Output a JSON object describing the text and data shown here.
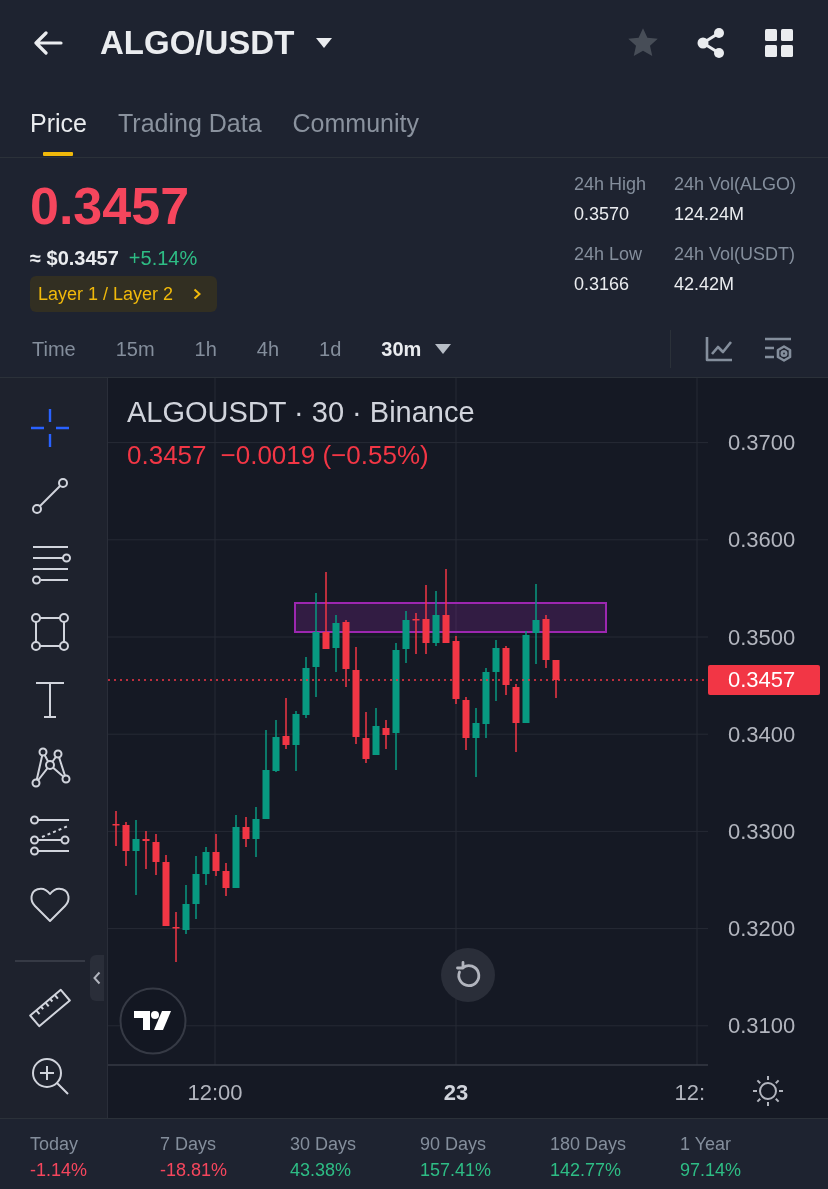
{
  "header": {
    "title": "ALGO/USDT",
    "favorited": false
  },
  "tabs": [
    {
      "label": "Price",
      "selected": true
    },
    {
      "label": "Trading Data",
      "selected": false
    },
    {
      "label": "Community",
      "selected": false
    }
  ],
  "ticker": {
    "price": "0.3457",
    "fiat_price": "≈ $0.3457",
    "change": "+5.14%",
    "category_tag": "Layer 1 / Layer 2"
  },
  "stats": [
    {
      "label": "24h High",
      "value": "0.3570"
    },
    {
      "label": "24h Vol(ALGO)",
      "value": "124.24M"
    },
    {
      "label": "24h Low",
      "value": "0.3166"
    },
    {
      "label": "24h Vol(USDT)",
      "value": "42.42M"
    }
  ],
  "intervals": [
    {
      "label": "Time",
      "selected": false,
      "has_menu": false
    },
    {
      "label": "15m",
      "selected": false,
      "has_menu": false
    },
    {
      "label": "1h",
      "selected": false,
      "has_menu": false
    },
    {
      "label": "4h",
      "selected": false,
      "has_menu": false
    },
    {
      "label": "1d",
      "selected": false,
      "has_menu": false
    },
    {
      "label": "30m",
      "selected": true,
      "has_menu": true
    }
  ],
  "drawing_tools": [
    {
      "kind": "crosshair",
      "selected": true
    },
    {
      "kind": "trend-line",
      "selected": false
    },
    {
      "kind": "fib",
      "selected": false
    },
    {
      "kind": "rectangle",
      "selected": false
    },
    {
      "kind": "text",
      "selected": false
    },
    {
      "kind": "pattern",
      "selected": false
    },
    {
      "kind": "forecast",
      "selected": false
    },
    {
      "kind": "favorites",
      "selected": false
    }
  ],
  "utility_tools": [
    {
      "kind": "ruler",
      "selected": false
    },
    {
      "kind": "zoom",
      "selected": false
    }
  ],
  "chart": {
    "symbol_line": "ALGOUSDT · 30 · Binance",
    "legend_price": "0.3457",
    "legend_change": "−0.0019 (−0.55%)",
    "price_axis": [
      "0.3700",
      "0.3600",
      "0.3500",
      "0.3400",
      "0.3300",
      "0.3200",
      "0.3100"
    ],
    "last_price": "0.3457",
    "time_axis": [
      {
        "label": "12:00",
        "kind": "time"
      },
      {
        "label": "23",
        "kind": "day"
      },
      {
        "label": "12:",
        "kind": "time"
      }
    ]
  },
  "performance": [
    {
      "period": "Today",
      "change": "-1.14%",
      "color": "#f6465d"
    },
    {
      "period": "7 Days",
      "change": "-18.81%",
      "color": "#f6465d"
    },
    {
      "period": "30 Days",
      "change": "43.38%",
      "color": "#2ebd85"
    },
    {
      "period": "90 Days",
      "change": "157.41%",
      "color": "#2ebd85"
    },
    {
      "period": "180 Days",
      "change": "142.77%",
      "color": "#2ebd85"
    },
    {
      "period": "1 Year",
      "change": "97.14%",
      "color": "#2ebd85"
    }
  ]
}
